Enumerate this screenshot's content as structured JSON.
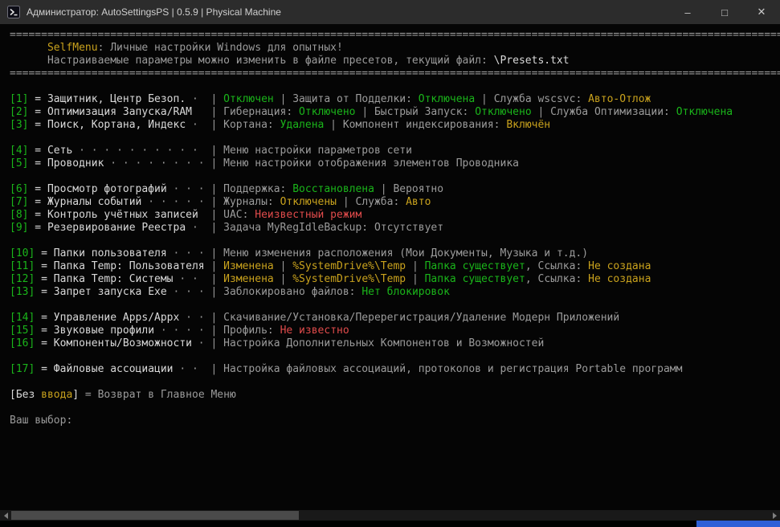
{
  "window": {
    "title": "Администратор: AutoSettingsPS | 0.5.9 | Physical Machine",
    "controls": {
      "minimize": "–",
      "maximize": "□",
      "close": "✕"
    }
  },
  "palette": {
    "green": "#1ab51a",
    "yellow": "#c9a21d",
    "red": "#e04b4b",
    "white": "#d9d9d9",
    "gray": "#9b9b9b"
  },
  "console": {
    "current_preset_file": "\\Presets.txt",
    "prompt": "Ваш выбор:",
    "lines": [
      [
        [
          "gray",
          "============================================================================================================================================"
        ]
      ],
      [
        [
          "yellow",
          "      SelfMenu"
        ],
        [
          "gray",
          ": Личные настройки Windows для опытных!"
        ]
      ],
      [
        [
          "gray",
          "      Настраиваемые параметры можно изменить в файле пресетов, текущий файл: "
        ],
        [
          "white",
          "\\Presets.txt"
        ]
      ],
      [
        [
          "gray",
          "============================================================================================================================================"
        ]
      ],
      [],
      [
        [
          "green",
          "[1]"
        ],
        [
          "white",
          " = Защитник, Центр Безоп."
        ],
        [
          "gray",
          " ·  | "
        ],
        [
          "green",
          "Отключен"
        ],
        [
          "gray",
          " | Защита от Подделки: "
        ],
        [
          "green",
          "Отключена"
        ],
        [
          "gray",
          " | Служба wscsvc: "
        ],
        [
          "yellow",
          "Авто-Отлож"
        ]
      ],
      [
        [
          "green",
          "[2]"
        ],
        [
          "white",
          " = Оптимизация Запуска/RAM"
        ],
        [
          "gray",
          "   | Гибернация: "
        ],
        [
          "green",
          "Отключено"
        ],
        [
          "gray",
          " | Быстрый Запуск: "
        ],
        [
          "green",
          "Отключено"
        ],
        [
          "gray",
          " | Служба Оптимизации: "
        ],
        [
          "green",
          "Отключена"
        ]
      ],
      [
        [
          "green",
          "[3]"
        ],
        [
          "white",
          " = Поиск, Кортана, Индекс"
        ],
        [
          "gray",
          " ·  | Кортана: "
        ],
        [
          "green",
          "Удалена"
        ],
        [
          "gray",
          " | Компонент индексирования: "
        ],
        [
          "yellow",
          "Включён"
        ]
      ],
      [],
      [
        [
          "green",
          "[4]"
        ],
        [
          "white",
          " = Сеть"
        ],
        [
          "gray",
          " · · · · · · · · · ·  | Меню настройки параметров сети"
        ]
      ],
      [
        [
          "green",
          "[5]"
        ],
        [
          "white",
          " = Проводник"
        ],
        [
          "gray",
          " · · · · · · · · | Меню настройки отображения элементов Проводника"
        ]
      ],
      [],
      [
        [
          "green",
          "[6]"
        ],
        [
          "white",
          " = Просмотр фотографий"
        ],
        [
          "gray",
          " · · · | Поддержка: "
        ],
        [
          "green",
          "Восстановлена"
        ],
        [
          "gray",
          " | Вероятно"
        ]
      ],
      [
        [
          "green",
          "[7]"
        ],
        [
          "white",
          " = Журналы событий"
        ],
        [
          "gray",
          " · · · · · | Журналы: "
        ],
        [
          "yellow",
          "Отключены"
        ],
        [
          "gray",
          " | Служба: "
        ],
        [
          "yellow",
          "Авто"
        ]
      ],
      [
        [
          "green",
          "[8]"
        ],
        [
          "white",
          " = Контроль учётных записей"
        ],
        [
          "gray",
          "  | UAC: "
        ],
        [
          "red",
          "Неизвестный режим"
        ]
      ],
      [
        [
          "green",
          "[9]"
        ],
        [
          "white",
          " = Резервирование Реестра"
        ],
        [
          "gray",
          " ·  | Задача MyRegIdleBackup: Отсутствует"
        ]
      ],
      [],
      [
        [
          "green",
          "[10]"
        ],
        [
          "white",
          " = Папки пользователя"
        ],
        [
          "gray",
          " · · · | Меню изменения расположения (Мои Документы, Музыка и т.д.)"
        ]
      ],
      [
        [
          "green",
          "[11]"
        ],
        [
          "white",
          " = Папка Temp: Пользователя"
        ],
        [
          "gray",
          " | "
        ],
        [
          "yellow",
          "Изменена"
        ],
        [
          "gray",
          " | "
        ],
        [
          "yellow",
          "%SystemDrive%\\Temp"
        ],
        [
          "gray",
          " | "
        ],
        [
          "green",
          "Папка существует"
        ],
        [
          "gray",
          ", Ссылка: "
        ],
        [
          "yellow",
          "Не создана"
        ]
      ],
      [
        [
          "green",
          "[12]"
        ],
        [
          "white",
          " = Папка Temp: Системы"
        ],
        [
          "gray",
          " · ·  | "
        ],
        [
          "yellow",
          "Изменена"
        ],
        [
          "gray",
          " | "
        ],
        [
          "yellow",
          "%SystemDrive%\\Temp"
        ],
        [
          "gray",
          " | "
        ],
        [
          "green",
          "Папка существует"
        ],
        [
          "gray",
          ", Ссылка: "
        ],
        [
          "yellow",
          "Не создана"
        ]
      ],
      [
        [
          "green",
          "[13]"
        ],
        [
          "white",
          " = Запрет запуска Exe"
        ],
        [
          "gray",
          " · · · | Заблокировано файлов: "
        ],
        [
          "green",
          "Нет блокировок"
        ]
      ],
      [],
      [
        [
          "green",
          "[14]"
        ],
        [
          "white",
          " = Управление Apps/Appx"
        ],
        [
          "gray",
          " · · | Скачивание/Установка/Перерегистрация/Удаление Модерн Приложений"
        ]
      ],
      [
        [
          "green",
          "[15]"
        ],
        [
          "white",
          " = Звуковые профили"
        ],
        [
          "gray",
          " · · · · | Профиль: "
        ],
        [
          "red",
          "Не известно"
        ]
      ],
      [
        [
          "green",
          "[16]"
        ],
        [
          "white",
          " = Компоненты/Возможности"
        ],
        [
          "gray",
          " · | Настройка Дополнительных Компонентов и Возможностей"
        ]
      ],
      [],
      [
        [
          "green",
          "[17]"
        ],
        [
          "white",
          " = Файловые ассоциации"
        ],
        [
          "gray",
          " · ·  | Настройка файловых ассоциаций, протоколов и регистрация Portable программ"
        ]
      ],
      [],
      [
        [
          "white",
          "[Без "
        ],
        [
          "yellow",
          "ввода"
        ],
        [
          "white",
          "]"
        ],
        [
          "gray",
          " = Возврат в Главное Меню"
        ]
      ],
      [],
      [
        [
          "gray",
          "Ваш выбор:"
        ]
      ]
    ]
  }
}
